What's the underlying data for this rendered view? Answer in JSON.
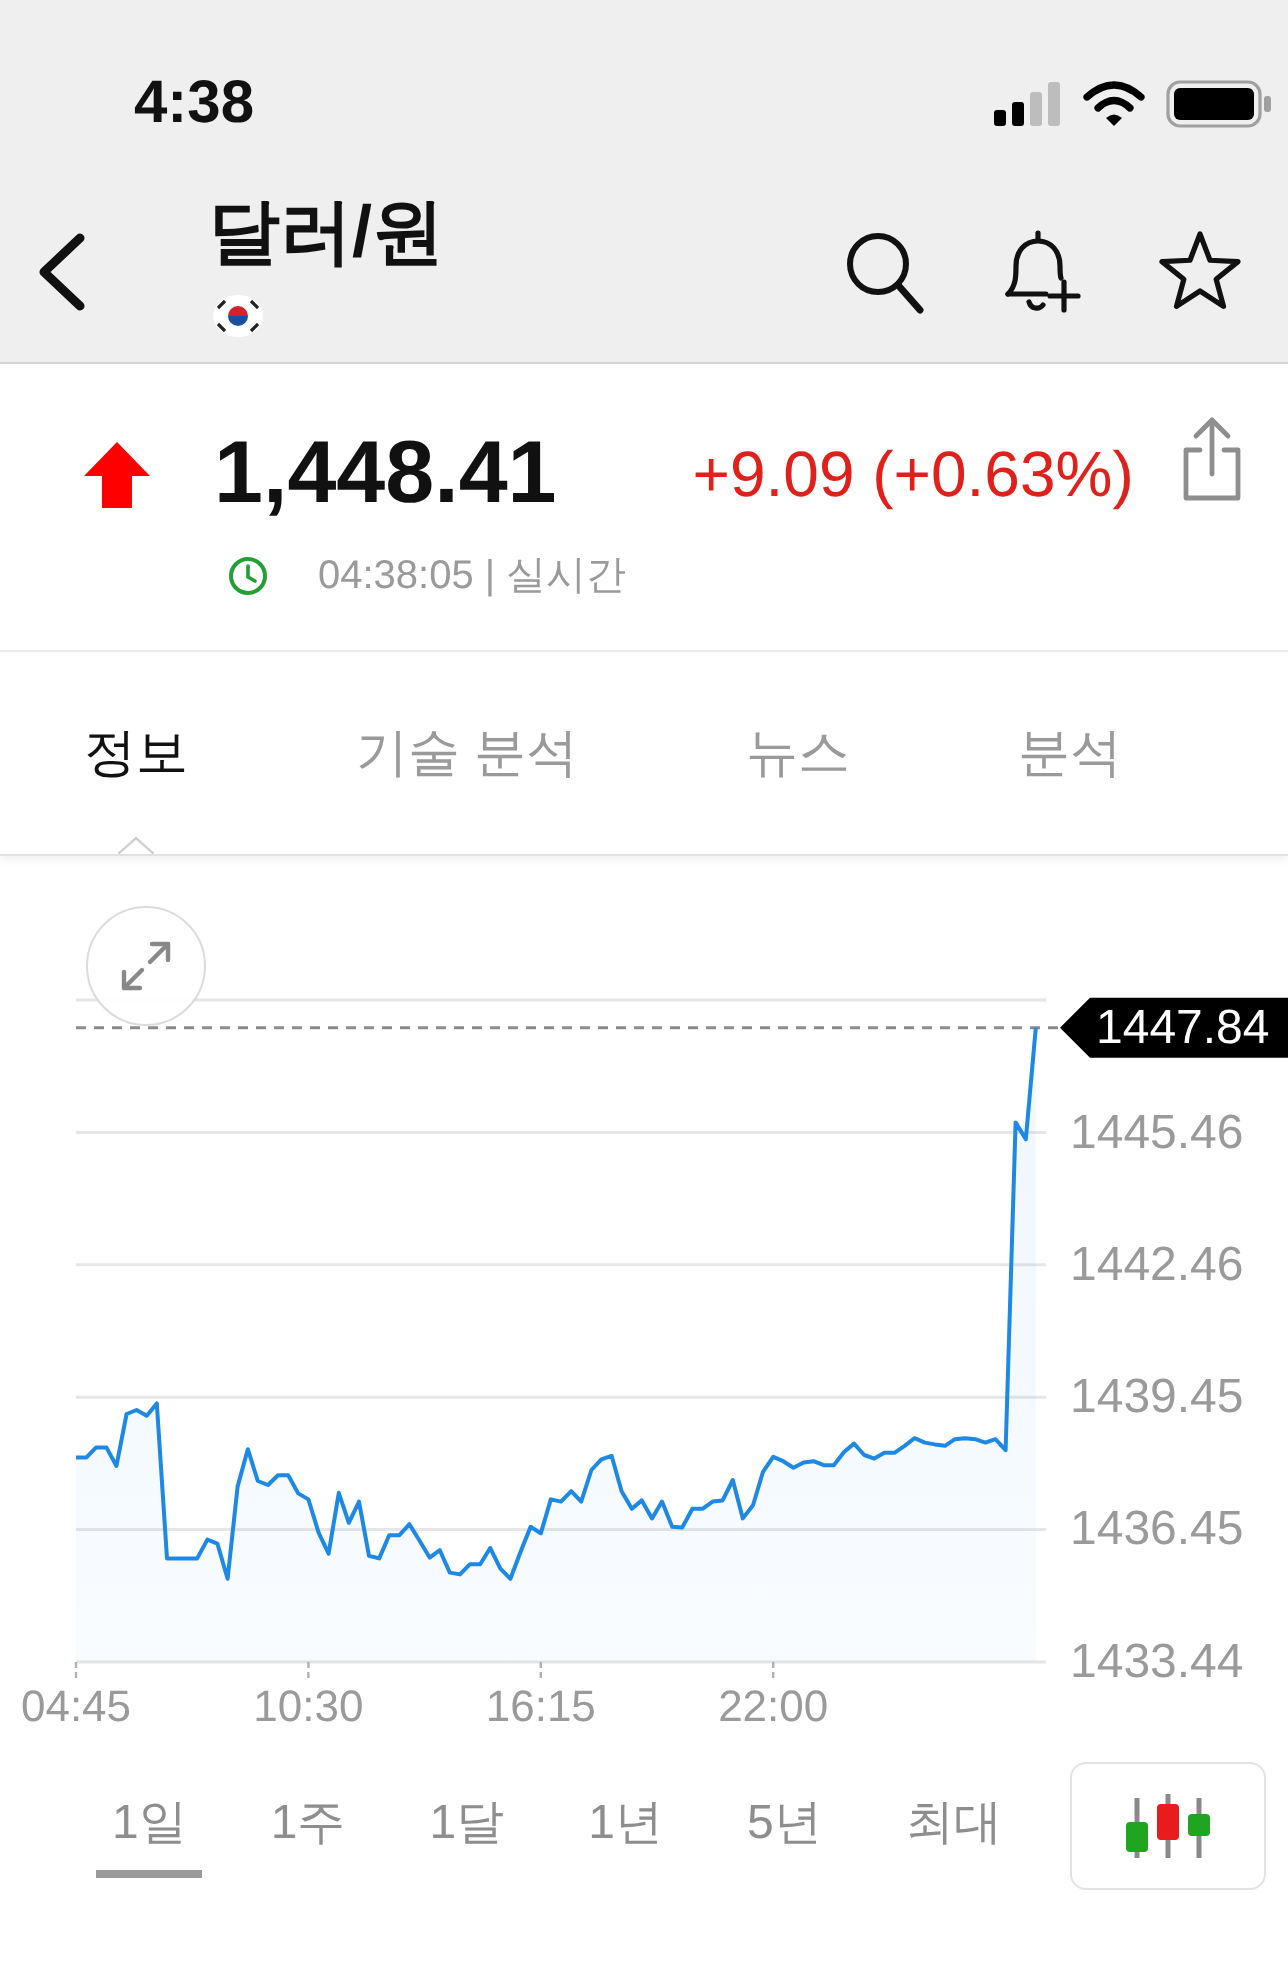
{
  "status_bar": {
    "time": "4:38"
  },
  "header": {
    "title": "달러/원"
  },
  "quote": {
    "rising": true,
    "price": "1,448.41",
    "change": "+9.09 (+0.63%)",
    "updated": "04:38:05 | 실시간"
  },
  "tabs": [
    {
      "label": "정보",
      "selected": true
    },
    {
      "label": "기술 분석",
      "selected": false
    },
    {
      "label": "뉴스",
      "selected": false
    },
    {
      "label": "분석",
      "selected": false
    }
  ],
  "chart": {
    "chart_data": {
      "type": "area",
      "x": [
        4.75,
        5,
        5.25,
        5.5,
        5.75,
        6,
        6.25,
        6.5,
        6.75,
        7,
        7.25,
        7.5,
        7.75,
        8,
        8.25,
        8.5,
        8.75,
        9,
        9.25,
        9.5,
        9.75,
        10,
        10.25,
        10.5,
        10.75,
        11,
        11.25,
        11.5,
        11.75,
        12,
        12.25,
        12.5,
        12.75,
        13,
        13.25,
        13.5,
        13.75,
        14,
        14.25,
        14.5,
        14.75,
        15,
        15.25,
        15.5,
        15.75,
        16,
        16.25,
        16.5,
        16.75,
        17,
        17.25,
        17.5,
        17.75,
        18,
        18.25,
        18.5,
        18.75,
        19,
        19.25,
        19.5,
        19.75,
        20,
        20.25,
        20.5,
        20.75,
        21,
        21.25,
        21.5,
        21.75,
        22,
        22.25,
        22.5,
        22.75,
        23,
        23.25,
        23.5,
        23.75,
        24,
        24.25,
        24.5,
        24.75,
        25,
        25.25,
        25.5,
        25.75,
        26,
        26.25,
        26.5,
        26.75,
        27,
        27.25,
        27.5,
        27.75,
        28,
        28.25,
        28.5
      ],
      "values": [
        1438.08,
        1438.08,
        1438.31,
        1438.31,
        1437.89,
        1439.07,
        1439.16,
        1439.03,
        1439.31,
        1435.79,
        1435.79,
        1435.79,
        1435.79,
        1436.22,
        1436.13,
        1435.33,
        1437.42,
        1438.27,
        1437.55,
        1437.46,
        1437.68,
        1437.68,
        1437.27,
        1437.13,
        1436.38,
        1435.9,
        1437.28,
        1436.6,
        1437.08,
        1435.85,
        1435.79,
        1436.32,
        1436.32,
        1436.57,
        1436.19,
        1435.81,
        1435.98,
        1435.47,
        1435.43,
        1435.66,
        1435.66,
        1436.03,
        1435.56,
        1435.33,
        1435.94,
        1436.51,
        1436.36,
        1437.13,
        1437.08,
        1437.32,
        1437.08,
        1437.8,
        1438.04,
        1438.12,
        1437.32,
        1436.92,
        1437.11,
        1436.7,
        1437.08,
        1436.51,
        1436.49,
        1436.92,
        1436.92,
        1437.08,
        1437.11,
        1437.57,
        1436.7,
        1437,
        1437.76,
        1438.1,
        1438,
        1437.85,
        1437.97,
        1438,
        1437.91,
        1437.91,
        1438.21,
        1438.4,
        1438.14,
        1438.06,
        1438.19,
        1438.19,
        1438.35,
        1438.52,
        1438.42,
        1438.38,
        1438.35,
        1438.5,
        1438.52,
        1438.5,
        1438.42,
        1438.5,
        1438.25,
        1445.69,
        1445.31,
        1447.84
      ],
      "xlim": [
        4.75,
        28.75
      ],
      "ylim": [
        1433.44,
        1448.47
      ],
      "xticks": [
        {
          "value": 4.75,
          "label": "04:45"
        },
        {
          "value": 10.5,
          "label": "10:30"
        },
        {
          "value": 16.25,
          "label": "16:15"
        },
        {
          "value": 22,
          "label": "22:00"
        }
      ],
      "yticks": [
        1433.44,
        1436.45,
        1439.45,
        1442.46,
        1445.46
      ],
      "grid": true,
      "ref_lines": [
        {
          "axis": "y",
          "value": 1447.84,
          "label": "1447.84"
        }
      ]
    }
  },
  "periods": [
    {
      "label": "1일",
      "selected": true
    },
    {
      "label": "1주",
      "selected": false
    },
    {
      "label": "1달",
      "selected": false
    },
    {
      "label": "1년",
      "selected": false
    },
    {
      "label": "5년",
      "selected": false
    },
    {
      "label": "최대",
      "selected": false
    }
  ]
}
